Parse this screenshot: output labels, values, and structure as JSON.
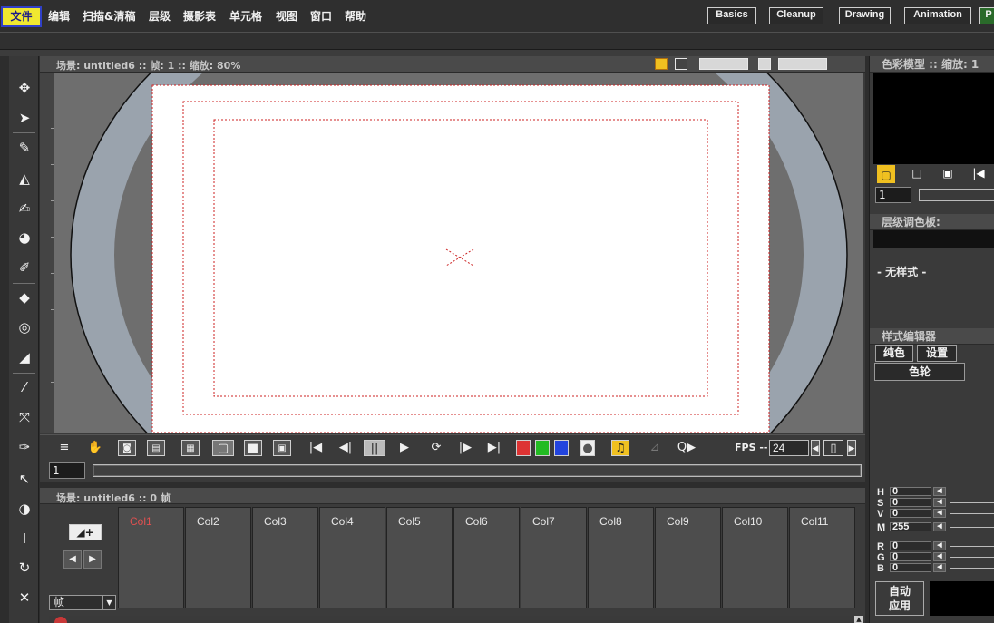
{
  "menu": {
    "items": [
      "文件",
      "编辑",
      "扫描&清稿",
      "层级",
      "摄影表",
      "单元格",
      "视图",
      "窗口",
      "帮助"
    ],
    "active_index": 0
  },
  "rooms": [
    "Basics",
    "Cleanup",
    "Drawing",
    "Animation",
    "P"
  ],
  "viewer": {
    "title_scene": "场景: untitled6",
    "title_frame": "帧: 1",
    "title_zoom": "缩放: 80%",
    "fps_label": "FPS -- /",
    "fps_value": "24",
    "frame_value": "1"
  },
  "xsheet": {
    "title": "场景: untitled6  ::  0 帧",
    "columns": [
      "Col1",
      "Col2",
      "Col3",
      "Col4",
      "Col5",
      "Col6",
      "Col7",
      "Col8",
      "Col9",
      "Col10",
      "Col11"
    ],
    "current_column": "Col1",
    "frame_select": "帧"
  },
  "right_panel": {
    "color_model_title": "色彩模型  ::  缩放: 1",
    "frame_value": "1",
    "level_palette_title": "层级调色板:",
    "no_style": "- 无样式 -",
    "style_editor_title": "样式编辑器",
    "tabs": [
      "纯色",
      "设置"
    ],
    "wheel_label": "色轮",
    "channels": [
      {
        "label": "H",
        "value": "0"
      },
      {
        "label": "S",
        "value": "0"
      },
      {
        "label": "V",
        "value": "0"
      },
      {
        "label": "M",
        "value": "255"
      },
      {
        "label": "R",
        "value": "0"
      },
      {
        "label": "G",
        "value": "0"
      },
      {
        "label": "B",
        "value": "0"
      }
    ],
    "auto_apply": "自动\n应用"
  },
  "colors": {
    "menu_active_bg": "#f0e830",
    "menu_active_border": "#3040c8",
    "current_column_text": "#e05050",
    "camera_guide": "#cc2222",
    "viewport_bg": "#6e6e6e",
    "table_ring": "#9aa3ad"
  },
  "icons": {
    "left_tools": [
      "animate-tool-icon",
      "selection-tool-icon",
      "brush-tool-icon",
      "geometric-tool-icon",
      "type-tool-icon",
      "fill-tool-icon",
      "paint-brush-tool-icon",
      "eraser-tool-icon",
      "tape-tool-icon",
      "style-picker-icon",
      "rgb-picker-icon",
      "control-point-editor-icon",
      "pinch-tool-icon",
      "pump-tool-icon",
      "magnet-tool-icon",
      "bender-tool-icon",
      "iron-tool-icon",
      "cutter-tool-icon",
      "skeleton-tool-icon"
    ]
  }
}
